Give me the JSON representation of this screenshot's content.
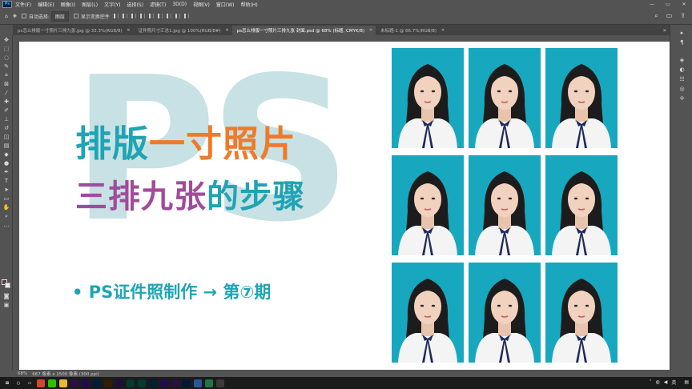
{
  "menubar": {
    "logo": "Ps",
    "items": [
      "文件(F)",
      "编辑(E)",
      "图像(I)",
      "图层(L)",
      "文字(Y)",
      "选择(S)",
      "滤镜(T)",
      "3D(D)",
      "视图(V)",
      "窗口(W)",
      "帮助(H)"
    ],
    "minimize": "—",
    "maximize": "▭",
    "close": "✕"
  },
  "options": {
    "auto_select_label": "自动选择:",
    "auto_select_value": "图层",
    "show_transform_label": "显示变换控件"
  },
  "tabs": [
    {
      "label": "ps怎么排版一寸照片三排九张.jpg @ 33.3%(RGB/8)",
      "active": false
    },
    {
      "label": "证件照尺寸汇总1.jpg @ 100%(RGB/8#)",
      "active": false
    },
    {
      "label": "ps怎么排版一寸照片三排九张 封面.psd @ 68% (标题, CMYK/8)",
      "active": true
    },
    {
      "label": "未标题-1 @ 66.7%(RGB/8)",
      "active": false
    }
  ],
  "tabs_more": "»",
  "canvas": {
    "watermark": "PS",
    "title_line1_a": "排版",
    "title_line1_b": "一寸照片",
    "title_line2_a": "三排九张",
    "title_line2_b": "的步骤",
    "subtitle": "• PS证件照制作 → 第⑦期"
  },
  "photo_grid": {
    "rows": 3,
    "cols": 3,
    "background_color": "#17a8bf"
  },
  "statusbar": {
    "zoom": "68%",
    "doc_info": "667 像素 x 1500 像素 (300 ppi)"
  },
  "taskbar": {
    "ime": "英",
    "time": "",
    "apps": [
      "start",
      "search",
      "task-view",
      "chrome",
      "wechat",
      "explorer",
      "premiere",
      "after-effects",
      "photoshop",
      "illustrator",
      "media-encoder",
      "audition",
      "audition2",
      "ps-active",
      "ae2",
      "pr2",
      "lightroom",
      "word",
      "excel",
      "media"
    ]
  },
  "colors": {
    "teal": "#1fa4b4",
    "orange": "#f07a2a",
    "purple": "#a04c9a",
    "watermark": "#c7e1e4",
    "photo_bg": "#17a8bf",
    "ui_gray": "#535353"
  }
}
